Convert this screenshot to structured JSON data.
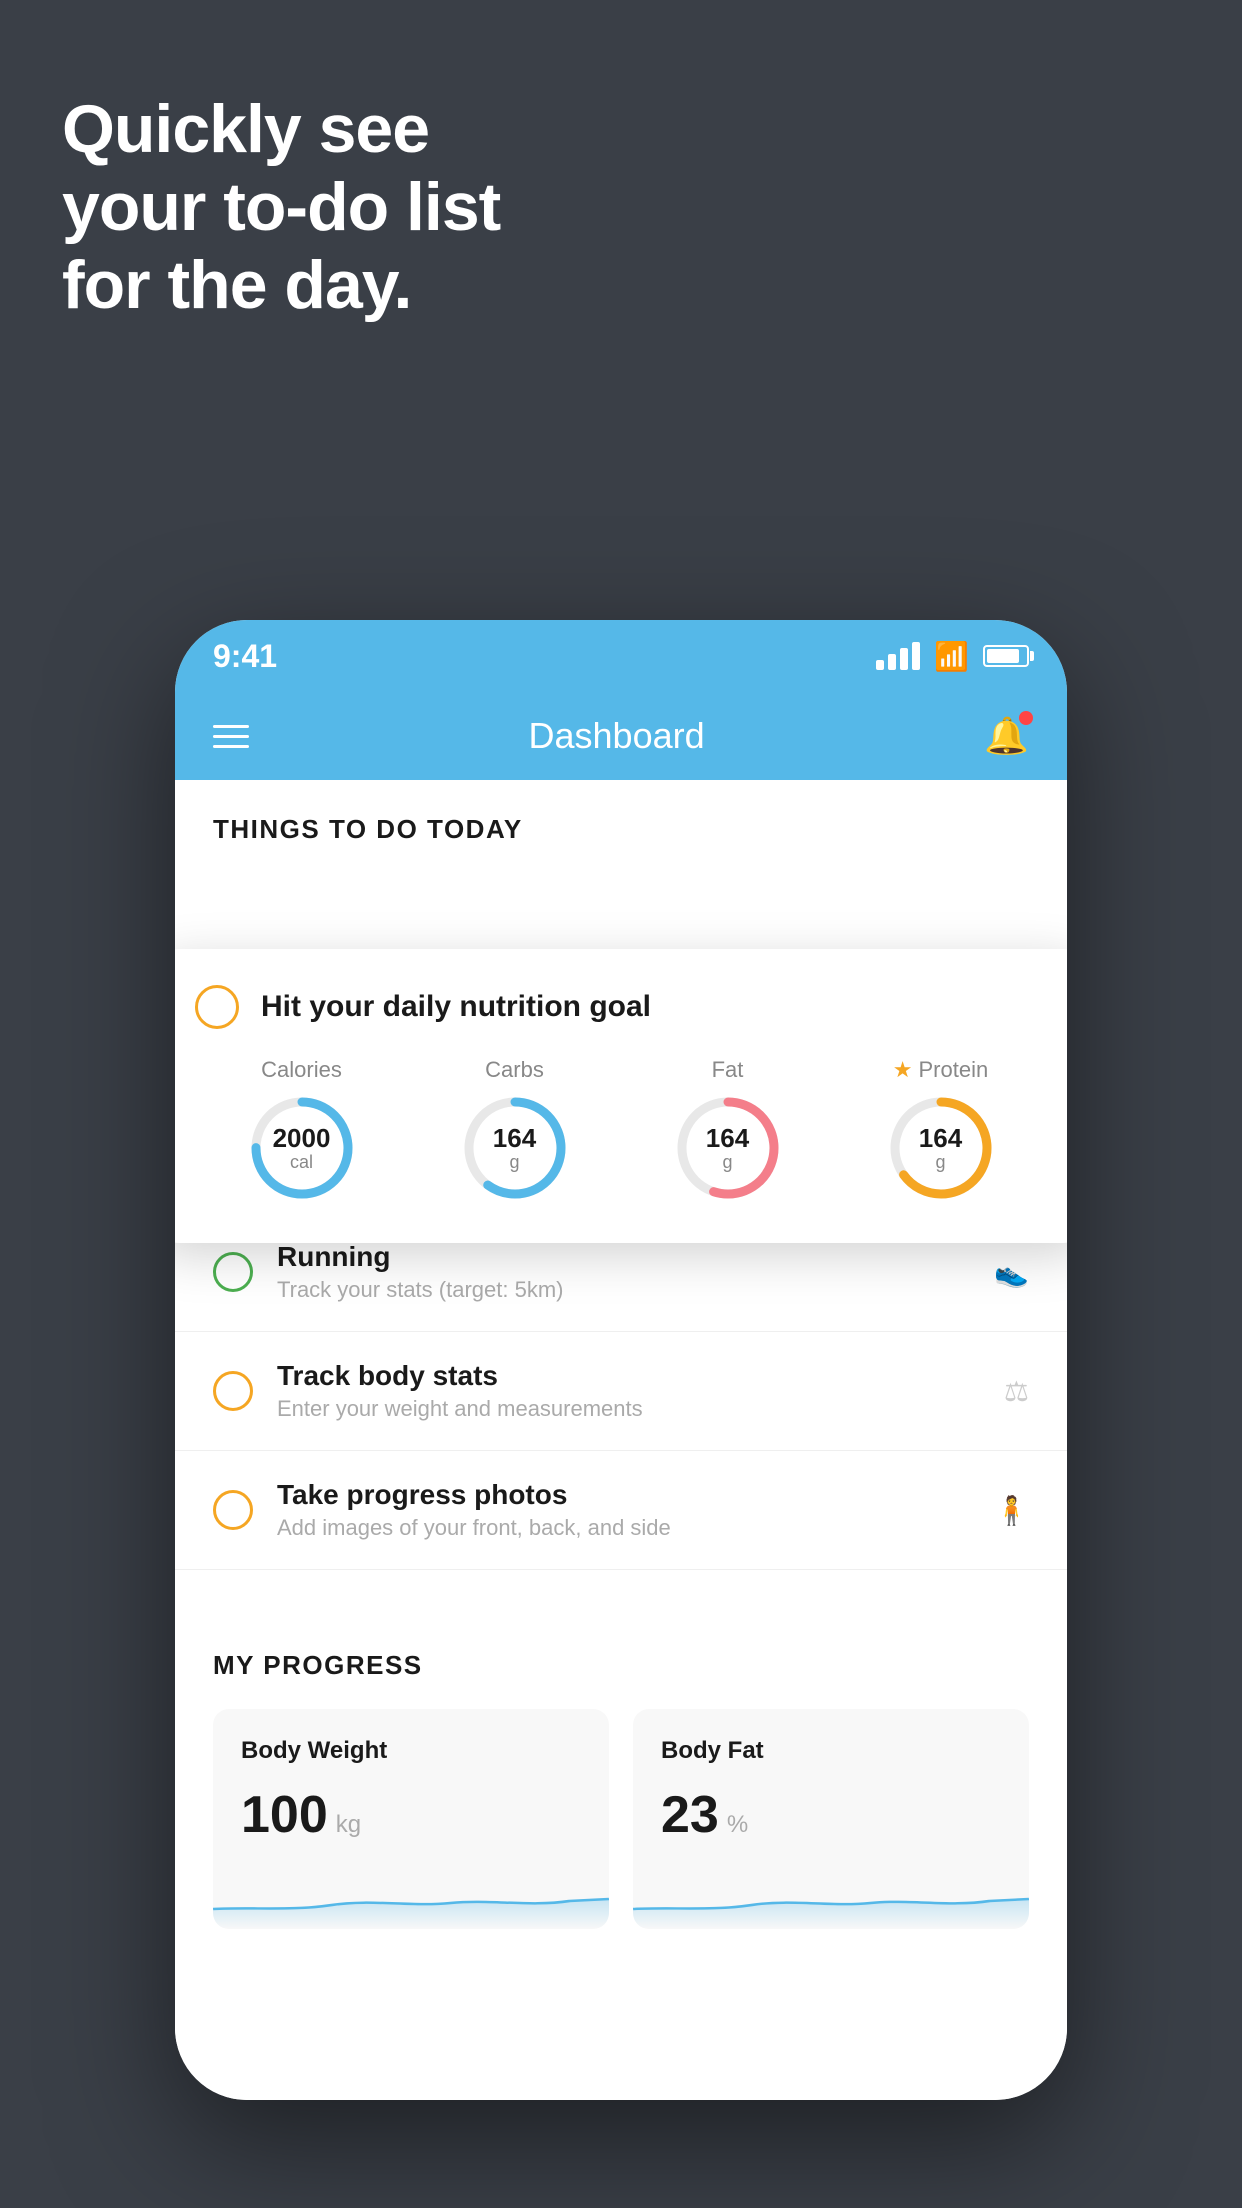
{
  "hero": {
    "line1": "Quickly see",
    "line2": "your to-do list",
    "line3": "for the day."
  },
  "status_bar": {
    "time": "9:41"
  },
  "nav": {
    "title": "Dashboard"
  },
  "things_section": {
    "heading": "THINGS TO DO TODAY"
  },
  "floating_card": {
    "title": "Hit your daily nutrition goal",
    "nutrients": [
      {
        "label": "Calories",
        "value": "2000",
        "unit": "cal",
        "color": "#55b8e8",
        "track_pct": 75,
        "star": false
      },
      {
        "label": "Carbs",
        "value": "164",
        "unit": "g",
        "color": "#55b8e8",
        "track_pct": 60,
        "star": false
      },
      {
        "label": "Fat",
        "value": "164",
        "unit": "g",
        "color": "#f47e8a",
        "track_pct": 55,
        "star": false
      },
      {
        "label": "Protein",
        "value": "164",
        "unit": "g",
        "color": "#f5a623",
        "track_pct": 65,
        "star": true
      }
    ]
  },
  "todo_items": [
    {
      "id": "running",
      "title": "Running",
      "subtitle": "Track your stats (target: 5km)",
      "circle_color": "green",
      "icon": "shoe"
    },
    {
      "id": "track-body",
      "title": "Track body stats",
      "subtitle": "Enter your weight and measurements",
      "circle_color": "yellow",
      "icon": "scale"
    },
    {
      "id": "progress-photos",
      "title": "Take progress photos",
      "subtitle": "Add images of your front, back, and side",
      "circle_color": "yellow2",
      "icon": "person"
    }
  ],
  "progress_section": {
    "heading": "MY PROGRESS",
    "cards": [
      {
        "id": "body-weight",
        "title": "Body Weight",
        "value": "100",
        "unit": "kg"
      },
      {
        "id": "body-fat",
        "title": "Body Fat",
        "value": "23",
        "unit": "%"
      }
    ]
  }
}
